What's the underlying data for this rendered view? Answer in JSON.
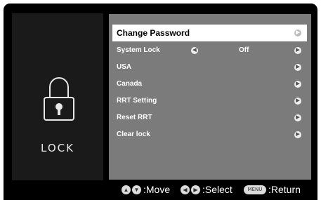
{
  "panel": {
    "title": "LOCK"
  },
  "menu": {
    "items": [
      {
        "label": "Change Password",
        "value": "",
        "selected": true
      },
      {
        "label": "System Lock",
        "value": "Off",
        "selected": false
      },
      {
        "label": "USA",
        "value": "",
        "selected": false
      },
      {
        "label": "Canada",
        "value": "",
        "selected": false
      },
      {
        "label": "RRT Setting",
        "value": "",
        "selected": false
      },
      {
        "label": "Reset RRT",
        "value": "",
        "selected": false
      },
      {
        "label": "Clear lock",
        "value": "",
        "selected": false
      }
    ]
  },
  "footer": {
    "move_label": ":Move",
    "select_label": ":Select",
    "menu_key": "MENU",
    "return_label": ":Return"
  },
  "icons": {
    "lock": "padlock-icon",
    "right_arrow": "chevron-right-icon",
    "left_arrow": "chevron-left-icon",
    "up_arrow": "chevron-up-icon",
    "down_arrow": "chevron-down-icon"
  }
}
